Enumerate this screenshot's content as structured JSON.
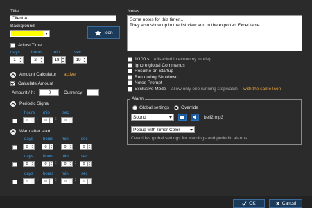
{
  "left": {
    "title_label": "Title",
    "title_value": "Client A",
    "background_label": "Background",
    "background_color": "#ffff00",
    "icon_button_label": "Icon",
    "adjust_time_label": "Adjust Time",
    "time_units": [
      "days",
      "hours",
      "min",
      "sec"
    ],
    "time_values": [
      "1",
      "2",
      "18",
      "19"
    ],
    "amount_calculator_label": "Amount Calculator",
    "amount_calculator_status": "active",
    "calculate_amount_label": "Calculate Amount",
    "amount_per_hour_label": "Amount / h:",
    "amount_per_hour_value": "0",
    "currency_label": "Currency:",
    "currency_value": "",
    "periodic_signal_label": "Periodic Signal",
    "periodic_units": [
      "hours",
      "min",
      "sec"
    ],
    "periodic_values": [
      "0",
      "0",
      "0"
    ],
    "warn_label": "Warn after start",
    "warn_units": [
      "days",
      "hours",
      "min",
      "sec"
    ],
    "warn_rows": [
      [
        "0",
        "0",
        "0",
        "0"
      ],
      [
        "0",
        "0",
        "0",
        "0"
      ],
      [
        "0",
        "0",
        "0",
        "0"
      ]
    ]
  },
  "right": {
    "notes_label": "Notes",
    "notes_text": "Some notes for this timer...\nThey also show up in the list view and in the exported Excel table",
    "options": [
      {
        "label": "1/100 s",
        "note": "(disabled in economy mode)",
        "checked": false
      },
      {
        "label": "Ignore global Commands",
        "note": "",
        "checked": false
      },
      {
        "label": "Resume on Startup",
        "note": "",
        "checked": false
      },
      {
        "label": "Run during Shutdown",
        "note": "",
        "checked": false
      },
      {
        "label": "Notes Prompt",
        "note": "",
        "checked": false
      },
      {
        "label": "Exclusive Mode",
        "note": "allow only one running stopwatch",
        "note2": "with the same Icon",
        "checked": false
      }
    ],
    "alarm": {
      "label": "Alarm",
      "radio_global": "Global settings",
      "radio_override": "Override",
      "selected": "Override",
      "sound_select": "Sound",
      "sound_file": "bell2.mp3",
      "popup_select": "Popup with Timer Color",
      "description": "Overrides global settings for warnings and periodic alarms"
    }
  },
  "footer": {
    "ok_label": "OK",
    "cancel_label": "Cancel"
  },
  "colors": {
    "window_bg": "#2b2b2b",
    "accent_blue": "#3b9de8",
    "accent_orange": "#e8a33c",
    "button_bg": "#1c3a5a"
  }
}
